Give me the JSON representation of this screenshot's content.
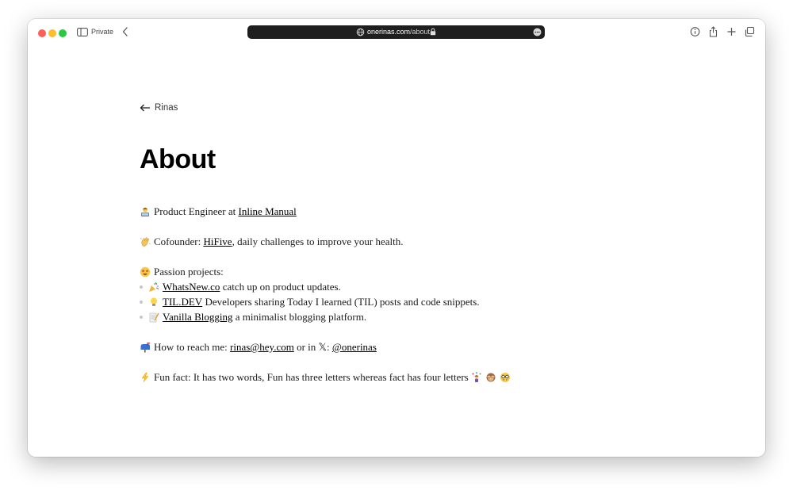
{
  "browser": {
    "private_label": "Private",
    "url_host": "onerinas.com",
    "url_path": "/about"
  },
  "page": {
    "back_label": "Rinas",
    "title": "About",
    "role": {
      "emoji": "technologist",
      "prefix": "Product Engineer at ",
      "link": "Inline Manual"
    },
    "cofounder": {
      "emoji": "waving-hand",
      "prefix": "Cofounder: ",
      "link": "HiFive",
      "suffix": ", daily challenges to improve your health."
    },
    "passion": {
      "emoji": "star-struck",
      "heading": "Passion projects:",
      "items": [
        {
          "emoji": "party-popper",
          "link": "WhatsNew.co",
          "text": " catch up on product updates."
        },
        {
          "emoji": "light-bulb",
          "link": "TIL.DEV",
          "text": " Developers sharing Today I learned (TIL) posts and code snippets."
        },
        {
          "emoji": "memo",
          "link": "Vanilla Blogging",
          "text": " a minimalist blogging platform."
        }
      ]
    },
    "contact": {
      "emoji": "mailbox",
      "prefix": "How to reach me: ",
      "email": "rinas@hey.com",
      "middle": " or in 𝕏: ",
      "handle": "@onerinas"
    },
    "fun_fact": {
      "emoji": "high-voltage",
      "text": "Fun fact: It has two words, Fun has three letters whereas fact has four letters",
      "trailing_emojis": [
        "woman-juggling",
        "see-no-evil-monkey",
        "nerd-face"
      ]
    }
  }
}
